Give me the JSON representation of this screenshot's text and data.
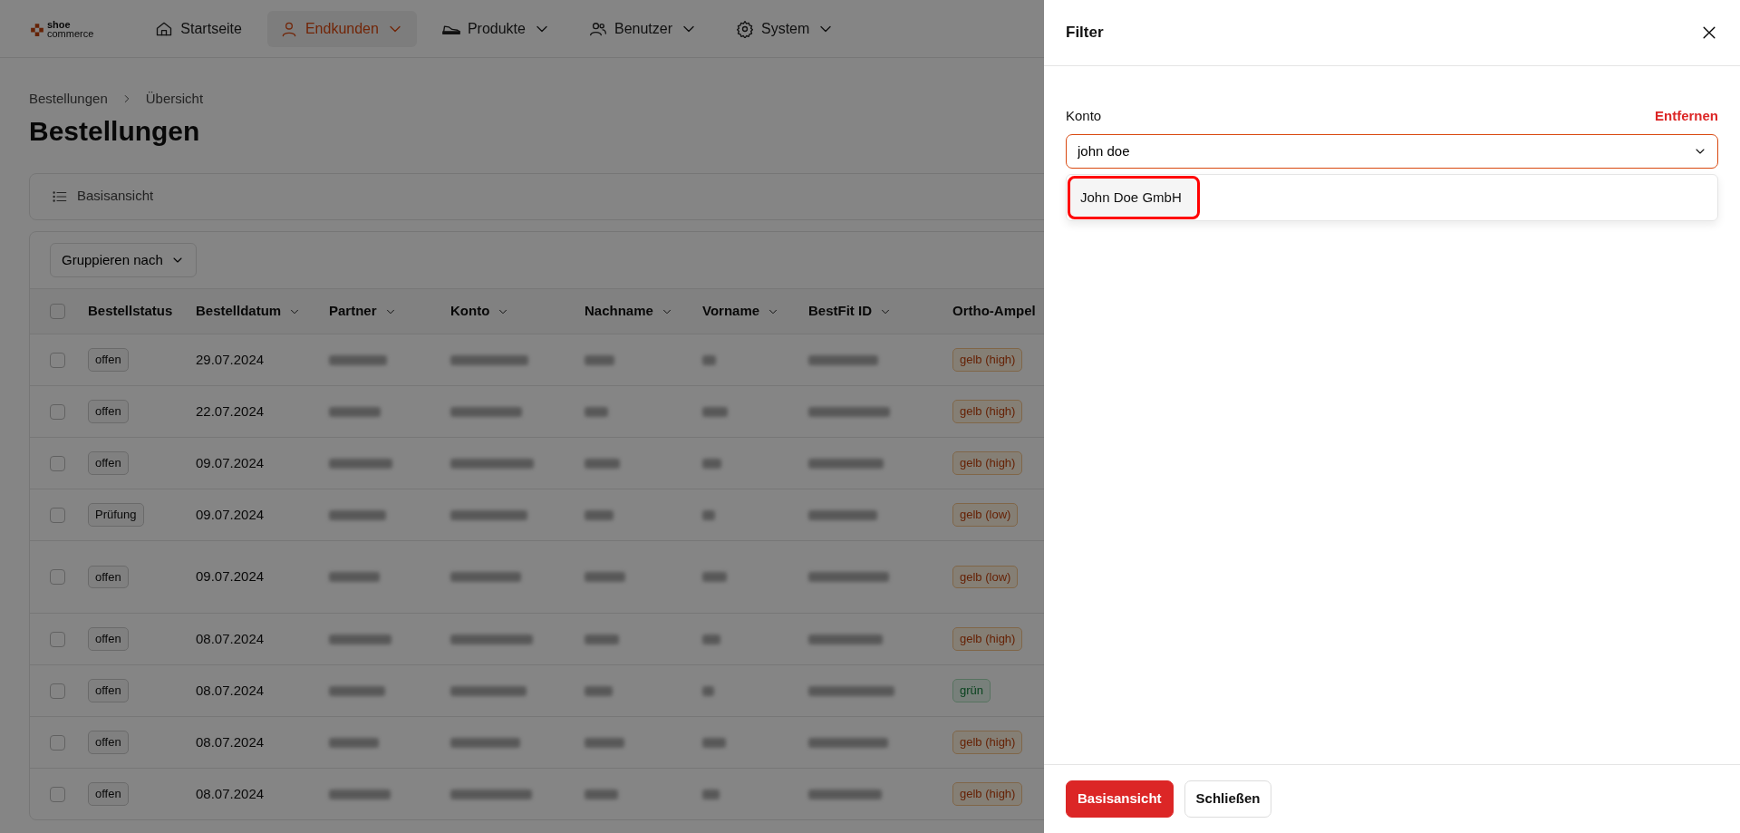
{
  "logo": {
    "line1": "shoe",
    "line2": "commerce"
  },
  "nav": [
    {
      "label": "Startseite",
      "dropdown": false,
      "selected": false
    },
    {
      "label": "Endkunden",
      "dropdown": true,
      "selected": true
    },
    {
      "label": "Produkte",
      "dropdown": true,
      "selected": false
    },
    {
      "label": "Benutzer",
      "dropdown": true,
      "selected": false
    },
    {
      "label": "System",
      "dropdown": true,
      "selected": false
    }
  ],
  "breadcrumb": [
    "Bestellungen",
    "Übersicht"
  ],
  "page_title": "Bestellungen",
  "view_bar": {
    "label": "Basisansicht"
  },
  "group_button": "Gruppieren nach",
  "table": {
    "all_checked": false,
    "columns": [
      {
        "label": "Bestellstatus",
        "sortable": false,
        "kind": "status"
      },
      {
        "label": "Bestelldatum",
        "sortable": true,
        "kind": "text"
      },
      {
        "label": "Partner",
        "sortable": true,
        "kind": "redacted"
      },
      {
        "label": "Konto",
        "sortable": true,
        "kind": "redacted"
      },
      {
        "label": "Nachname",
        "sortable": true,
        "kind": "redacted"
      },
      {
        "label": "Vorname",
        "sortable": true,
        "kind": "redacted"
      },
      {
        "label": "BestFit ID",
        "sortable": true,
        "kind": "redacted"
      },
      {
        "label": "Ortho-Ampel",
        "sortable": false,
        "kind": "ampel"
      }
    ],
    "rows": [
      {
        "status": "offen",
        "date": "29.07.2024",
        "ampel": {
          "label": "gelb (high)",
          "kind": "warning"
        },
        "checked": false
      },
      {
        "status": "offen",
        "date": "22.07.2024",
        "ampel": {
          "label": "gelb (high)",
          "kind": "warning"
        },
        "checked": false
      },
      {
        "status": "offen",
        "date": "09.07.2024",
        "ampel": {
          "label": "gelb (high)",
          "kind": "warning"
        },
        "checked": false
      },
      {
        "status": "Prüfung",
        "date": "09.07.2024",
        "ampel": {
          "label": "gelb (low)",
          "kind": "warning"
        },
        "checked": false
      },
      {
        "status": "offen",
        "date": "09.07.2024",
        "ampel": {
          "label": "gelb (low)",
          "kind": "warning"
        },
        "checked": false
      },
      {
        "status": "offen",
        "date": "08.07.2024",
        "ampel": {
          "label": "gelb (high)",
          "kind": "warning"
        },
        "checked": false
      },
      {
        "status": "offen",
        "date": "08.07.2024",
        "ampel": {
          "label": "grün",
          "kind": "success"
        },
        "checked": false
      },
      {
        "status": "offen",
        "date": "08.07.2024",
        "ampel": {
          "label": "gelb (high)",
          "kind": "warning"
        },
        "checked": false
      },
      {
        "status": "offen",
        "date": "08.07.2024",
        "ampel": {
          "label": "gelb (high)",
          "kind": "warning"
        },
        "checked": false
      }
    ]
  },
  "filter_panel": {
    "title": "Filter",
    "field_label": "Konto",
    "remove_link": "Entfernen",
    "value": "john doe",
    "options": [
      {
        "label": "John Doe GmbH",
        "highlighted": true
      }
    ],
    "buttons": [
      {
        "label": "Basisansicht",
        "kind": "primary"
      },
      {
        "label": "Schließen",
        "kind": "secondary"
      }
    ]
  }
}
